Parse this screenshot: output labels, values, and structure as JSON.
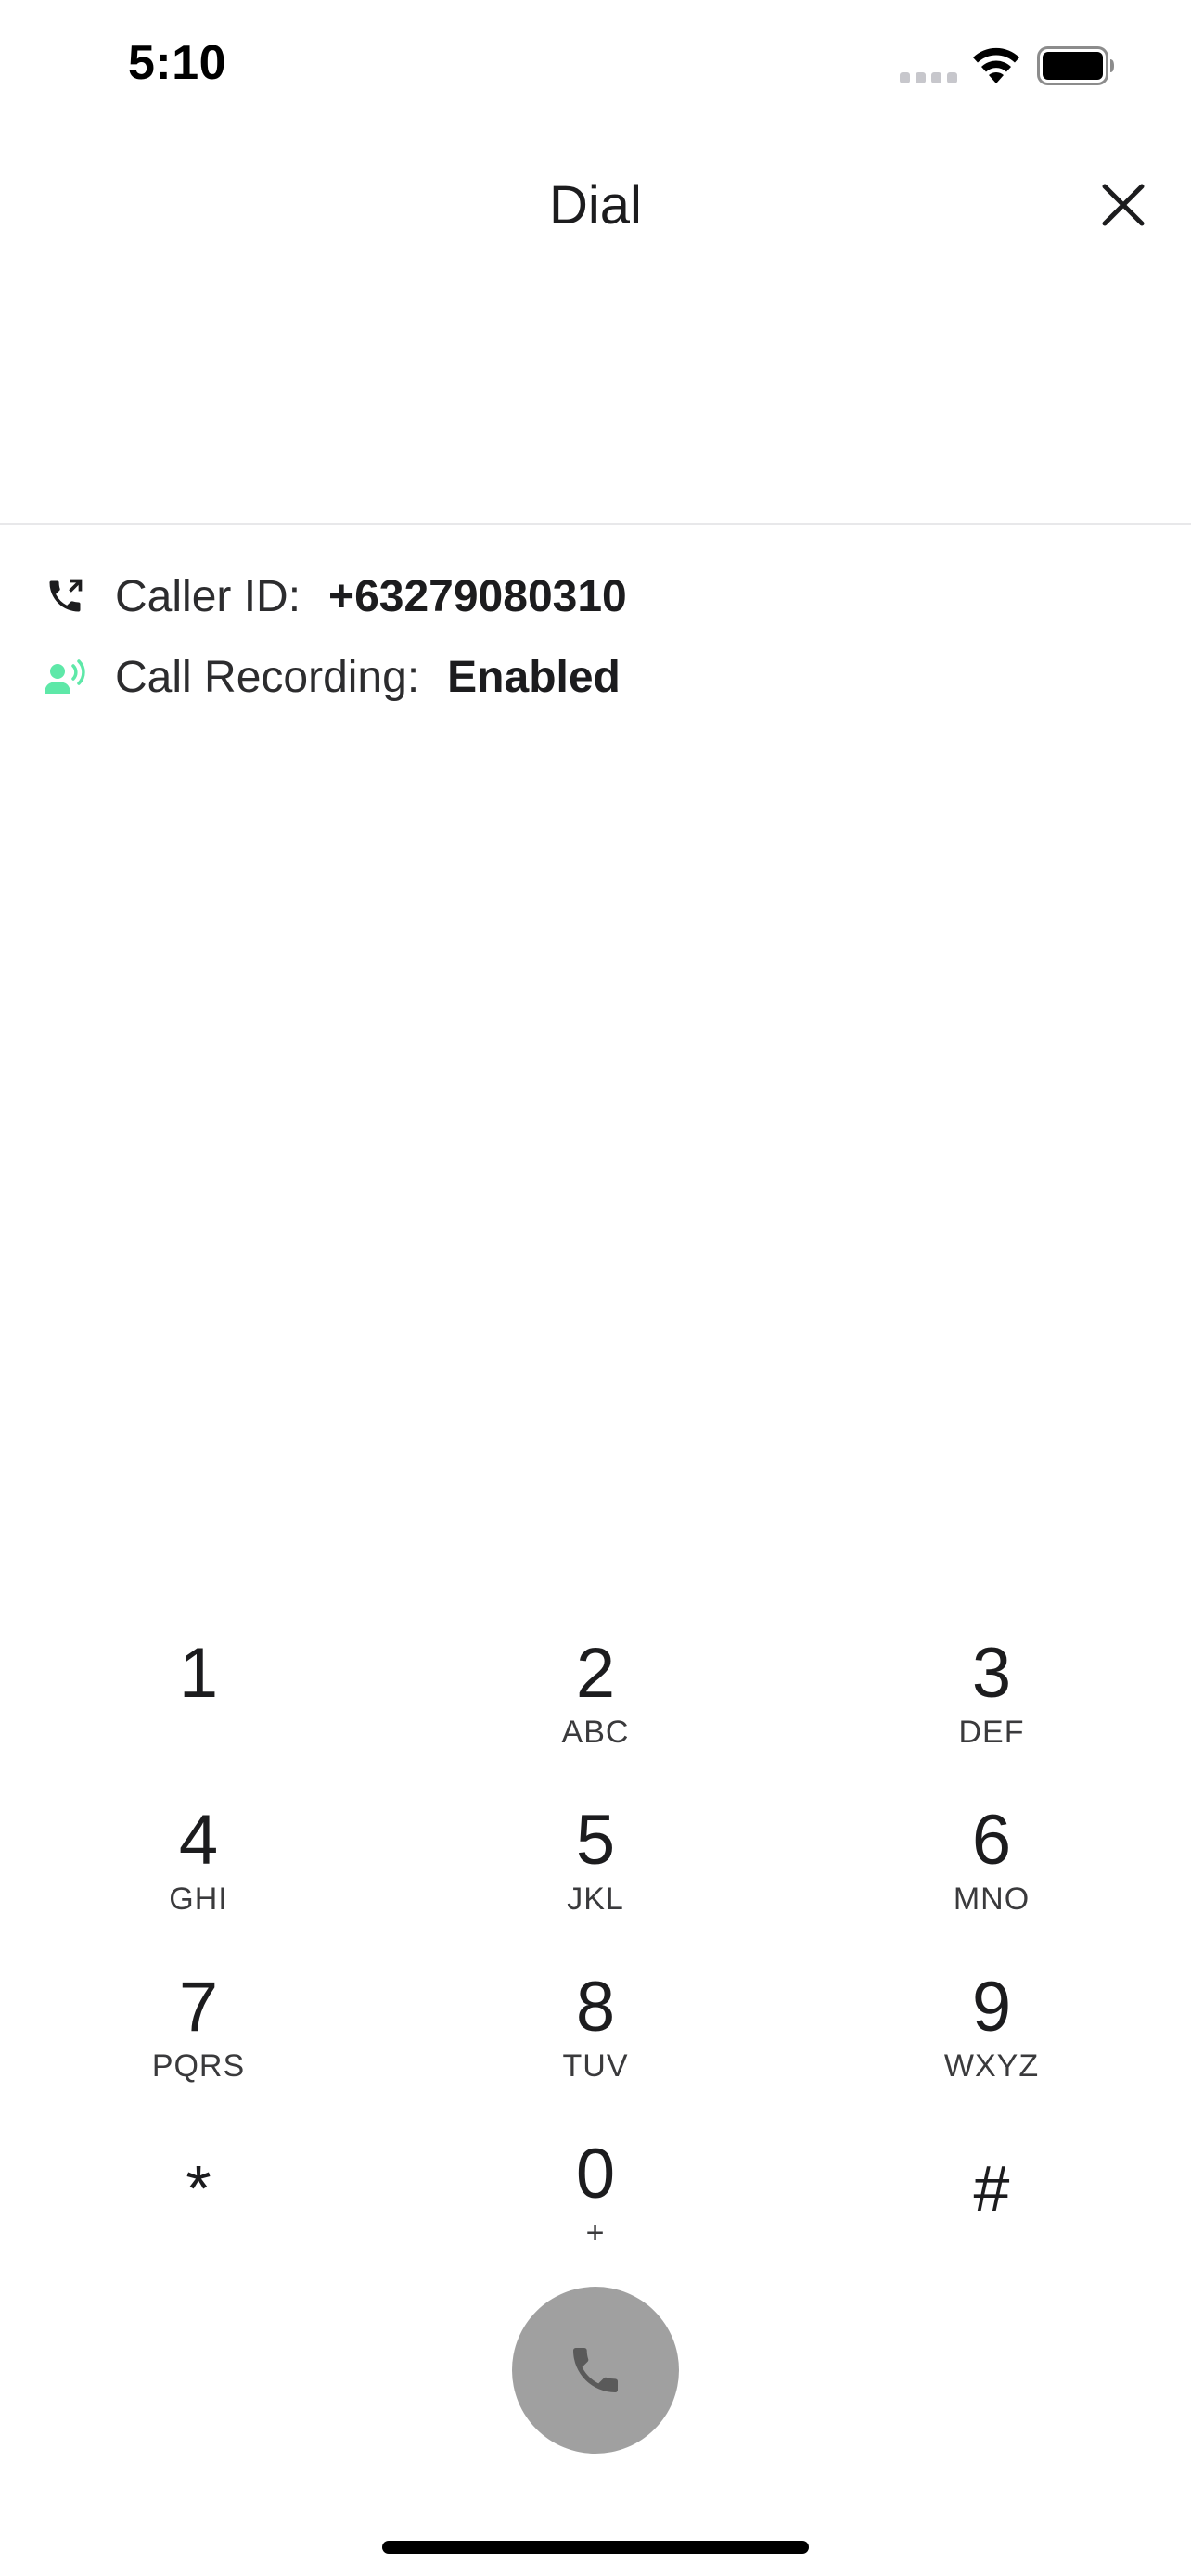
{
  "status_bar": {
    "time": "5:10"
  },
  "header": {
    "title": "Dial"
  },
  "display": {
    "number": ""
  },
  "info": {
    "caller_id_label": "Caller ID:",
    "caller_id_value": "+63279080310",
    "recording_label": "Call Recording:",
    "recording_value": "Enabled"
  },
  "keypad": {
    "keys": [
      {
        "digit": "1",
        "letters": ""
      },
      {
        "digit": "2",
        "letters": "ABC"
      },
      {
        "digit": "3",
        "letters": "DEF"
      },
      {
        "digit": "4",
        "letters": "GHI"
      },
      {
        "digit": "5",
        "letters": "JKL"
      },
      {
        "digit": "6",
        "letters": "MNO"
      },
      {
        "digit": "7",
        "letters": "PQRS"
      },
      {
        "digit": "8",
        "letters": "TUV"
      },
      {
        "digit": "9",
        "letters": "WXYZ"
      },
      {
        "digit": "*",
        "letters": ""
      },
      {
        "digit": "0",
        "letters": "+"
      },
      {
        "digit": "#",
        "letters": ""
      }
    ]
  },
  "colors": {
    "recording_icon": "#5ee8a8",
    "call_button": "#a0a0a0",
    "divider": "#e8e8ea"
  },
  "icons": {
    "caller_id": "phone-outgoing-icon",
    "recording": "voice-recording-icon",
    "call": "phone-icon",
    "close": "close-icon"
  }
}
